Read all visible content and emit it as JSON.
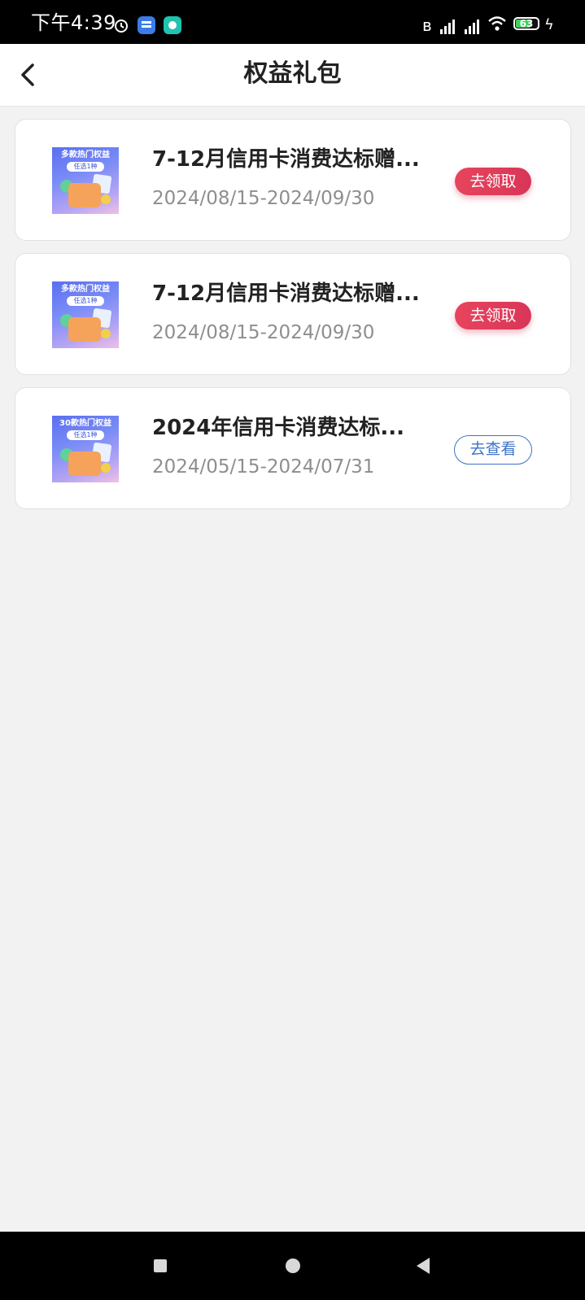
{
  "status_bar": {
    "time": "下午4:39",
    "battery_level": "63"
  },
  "header": {
    "title": "权益礼包"
  },
  "cards": [
    {
      "thumb_tag": "多款热门权益",
      "thumb_sub": "任选1种",
      "title": "7-12月信用卡消费达标赠...",
      "date": "2024/08/15-2024/09/30",
      "button": "去领取"
    },
    {
      "thumb_tag": "多款热门权益",
      "thumb_sub": "任选1种",
      "title": "7-12月信用卡消费达标赠...",
      "date": "2024/08/15-2024/09/30",
      "button": "去领取"
    },
    {
      "thumb_tag": "30款热门权益",
      "thumb_sub": "任选1种",
      "title": "2024年信用卡消费达标...",
      "date": "2024/05/15-2024/07/31",
      "button": "去查看"
    }
  ],
  "colors": {
    "claim_button": "#e03f5b",
    "view_button": "#3d72c8",
    "page_background": "#f2f2f2"
  }
}
